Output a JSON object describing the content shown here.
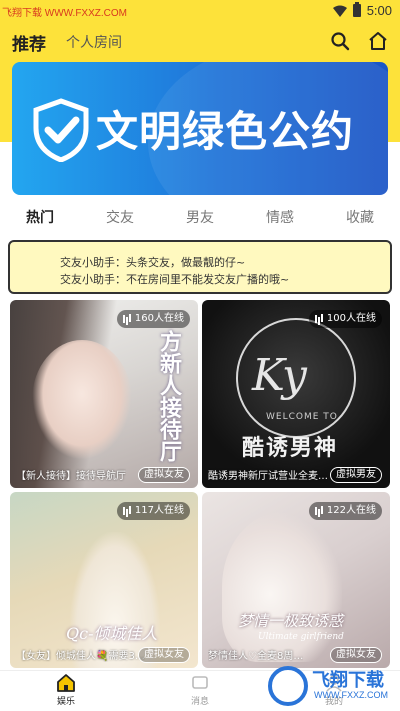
{
  "status_bar": {
    "watermark": "飞翔下载 WWW.FXXZ.COM",
    "time": "5:00"
  },
  "header": {
    "tab_recommend": "推荐",
    "tab_personal_room": "个人房间",
    "icons": [
      "search-icon",
      "home-icon"
    ]
  },
  "banner": {
    "text": "文明绿色公约",
    "colors": {
      "start": "#23a6f0",
      "end": "#1b55c6"
    }
  },
  "category_tabs": [
    {
      "label": "热门",
      "active": true
    },
    {
      "label": "交友",
      "active": false
    },
    {
      "label": "男友",
      "active": false
    },
    {
      "label": "情感",
      "active": false
    },
    {
      "label": "收藏",
      "active": false
    }
  ],
  "notice": {
    "line1": "交友小助手：头条交友，做最靓的仔~",
    "line2": "交友小助手：不在房间里不能发交友广播的哦~"
  },
  "rooms": [
    {
      "online": "160人在线",
      "title": "【新人接待】接待导航厅",
      "badge": "虚拟女友",
      "art_text": "方新人接待厅"
    },
    {
      "online": "100人在线",
      "title": "酷诱男神新厅试营业全麦…",
      "badge": "虚拟男友",
      "art_text": "Ky",
      "art_sub": "WELCOME TO",
      "art_cn": "酷诱男神"
    },
    {
      "online": "117人在线",
      "title": "【女友】倾城佳人💐需要3…",
      "badge": "虚拟女友",
      "art_text": "Qc-倾城佳人"
    },
    {
      "online": "122人在线",
      "title": "梦情佳人♡全麦8周…",
      "badge": "虚拟女友",
      "art_text": "梦情一极致诱惑",
      "art_sub": "Ultimate girlfriend"
    }
  ],
  "bottom_nav": [
    {
      "label": "娱乐",
      "icon": "home-icon",
      "active": true
    },
    {
      "label": "消息",
      "icon": "message-icon",
      "active": false
    },
    {
      "label": "我的",
      "icon": "profile-icon",
      "active": false
    }
  ],
  "corner_watermark": {
    "brand": "飞翔下载",
    "url": "WWW.FXXZ.COM"
  },
  "colors": {
    "accent_yellow": "#fde23a",
    "notice_bg": "#fff9bf"
  }
}
